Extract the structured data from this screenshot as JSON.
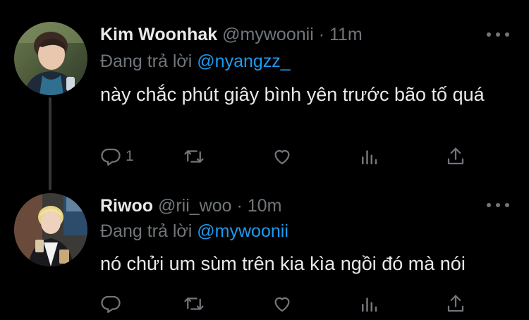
{
  "tweets": [
    {
      "author_name": "Kim Woonhak",
      "handle": "@mywoonii",
      "separator": "·",
      "time": "11m",
      "reply_prefix": "Đang trả lời",
      "reply_to": "@nyangzz_",
      "text": "này chắc phút giây bình yên trước bão tố quá",
      "reply_count": "1"
    },
    {
      "author_name": "Riwoo",
      "handle": "@rii_woo",
      "separator": "·",
      "time": "10m",
      "reply_prefix": "Đang trả lời",
      "reply_to": "@mywoonii",
      "text": "nó chửi um sùm trên kia kìa ngồi đó mà nói"
    }
  ],
  "colors": {
    "background": "#000000",
    "text_primary": "#e7e9ea",
    "text_secondary": "#71767b",
    "accent_blue": "#1d9bf0",
    "thread_line": "#333639"
  },
  "icons": [
    "reply-icon",
    "retweet-icon",
    "like-icon",
    "views-icon",
    "share-icon",
    "more-icon"
  ]
}
